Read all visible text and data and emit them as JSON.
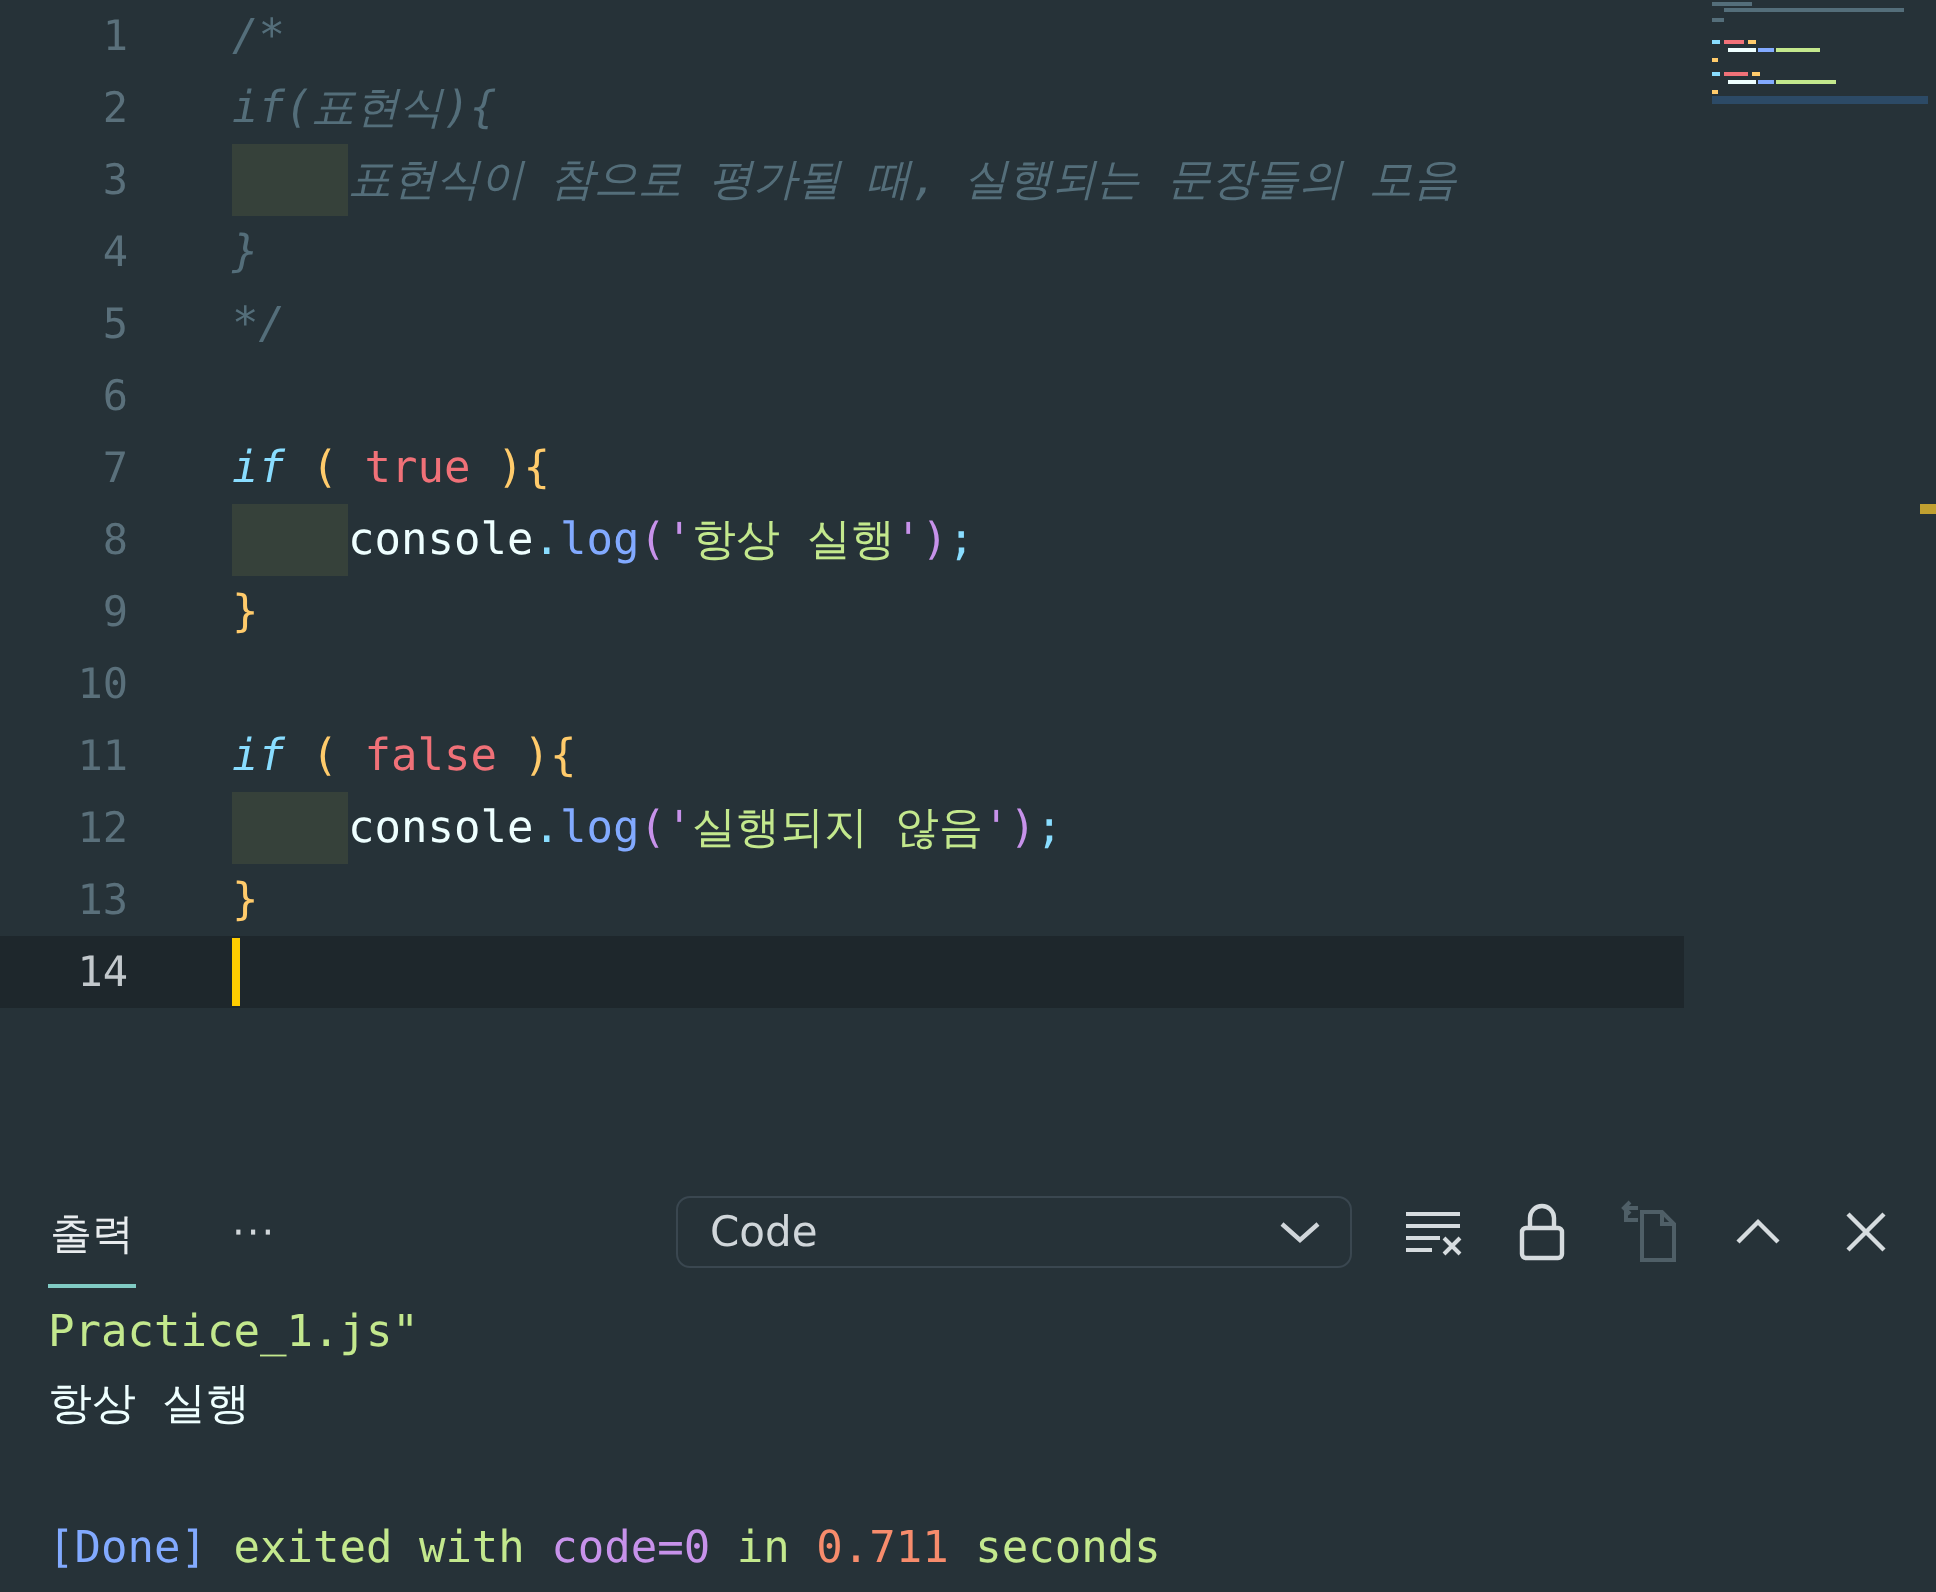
{
  "editor": {
    "lines": [
      {
        "number": "1",
        "indented": false,
        "selected": false,
        "tokens": [
          {
            "kind": "comment",
            "text": "/*"
          }
        ]
      },
      {
        "number": "2",
        "indented": false,
        "selected": false,
        "tokens": [
          {
            "kind": "comment",
            "text": "if(표현식){"
          }
        ]
      },
      {
        "number": "3",
        "indented": true,
        "selected": false,
        "tokens": [
          {
            "kind": "comment",
            "text": "표현식이 참으로 평가될 때, 실행되는 문장들의 모음"
          }
        ]
      },
      {
        "number": "4",
        "indented": false,
        "selected": false,
        "tokens": [
          {
            "kind": "comment",
            "text": "}"
          }
        ]
      },
      {
        "number": "5",
        "indented": false,
        "selected": false,
        "tokens": [
          {
            "kind": "comment",
            "text": "*/"
          }
        ]
      },
      {
        "number": "6",
        "indented": false,
        "selected": false
      },
      {
        "number": "7",
        "indented": false,
        "selected": false,
        "tokens": [
          {
            "kind": "keyword",
            "text": "if"
          },
          {
            "kind": "brace",
            "text": " ( "
          },
          {
            "kind": "bool",
            "text": "true"
          },
          {
            "kind": "brace",
            "text": " ){"
          }
        ]
      },
      {
        "number": "8",
        "indented": true,
        "selected": false,
        "tokens": [
          {
            "kind": "plain",
            "text": "console"
          },
          {
            "kind": "punct",
            "text": "."
          },
          {
            "kind": "method",
            "text": "log"
          },
          {
            "kind": "paren",
            "text": "('"
          },
          {
            "kind": "string",
            "text": "항상 실행"
          },
          {
            "kind": "paren",
            "text": "')"
          },
          {
            "kind": "punct",
            "text": ";"
          }
        ]
      },
      {
        "number": "9",
        "indented": false,
        "selected": false,
        "tokens": [
          {
            "kind": "brace",
            "text": "}"
          }
        ]
      },
      {
        "number": "10",
        "indented": false,
        "selected": false
      },
      {
        "number": "11",
        "indented": false,
        "selected": false,
        "tokens": [
          {
            "kind": "keyword",
            "text": "if"
          },
          {
            "kind": "brace",
            "text": " ( "
          },
          {
            "kind": "bool",
            "text": "false"
          },
          {
            "kind": "brace",
            "text": " ){"
          }
        ]
      },
      {
        "number": "12",
        "indented": true,
        "selected": false,
        "tokens": [
          {
            "kind": "plain",
            "text": "console"
          },
          {
            "kind": "punct",
            "text": "."
          },
          {
            "kind": "method",
            "text": "log"
          },
          {
            "kind": "paren",
            "text": "('"
          },
          {
            "kind": "string",
            "text": "실행되지 않음"
          },
          {
            "kind": "paren",
            "text": "')"
          },
          {
            "kind": "punct",
            "text": ";"
          }
        ]
      },
      {
        "number": "13",
        "indented": false,
        "selected": false,
        "tokens": [
          {
            "kind": "brace",
            "text": "}"
          }
        ]
      },
      {
        "number": "14",
        "indented": false,
        "selected": true
      }
    ]
  },
  "panel": {
    "tabs": [
      {
        "label": "출력",
        "selected": true
      }
    ],
    "more": "···",
    "channel": "Code",
    "actions": [
      {
        "kind": "clear",
        "disabled": false
      },
      {
        "kind": "lock",
        "disabled": false
      },
      {
        "kind": "copy",
        "disabled": true
      },
      {
        "kind": "maximize",
        "disabled": false
      },
      {
        "kind": "close",
        "disabled": false
      }
    ],
    "output": [
      {
        "kind": "line",
        "segments": [
          {
            "kind": "path",
            "text": "Practice_1.js\""
          }
        ]
      },
      {
        "kind": "line",
        "segments": [
          {
            "kind": "text",
            "text": "항상 실행"
          }
        ]
      },
      {
        "kind": "status",
        "segments": [
          {
            "kind": "bracket",
            "text": "[Done]"
          },
          {
            "kind": "path",
            "text": " exited with "
          },
          {
            "kind": "code",
            "text": "code=0"
          },
          {
            "kind": "path",
            "text": " in "
          },
          {
            "kind": "number",
            "text": "0.711"
          },
          {
            "kind": "path",
            "text": " seconds"
          }
        ]
      }
    ]
  }
}
